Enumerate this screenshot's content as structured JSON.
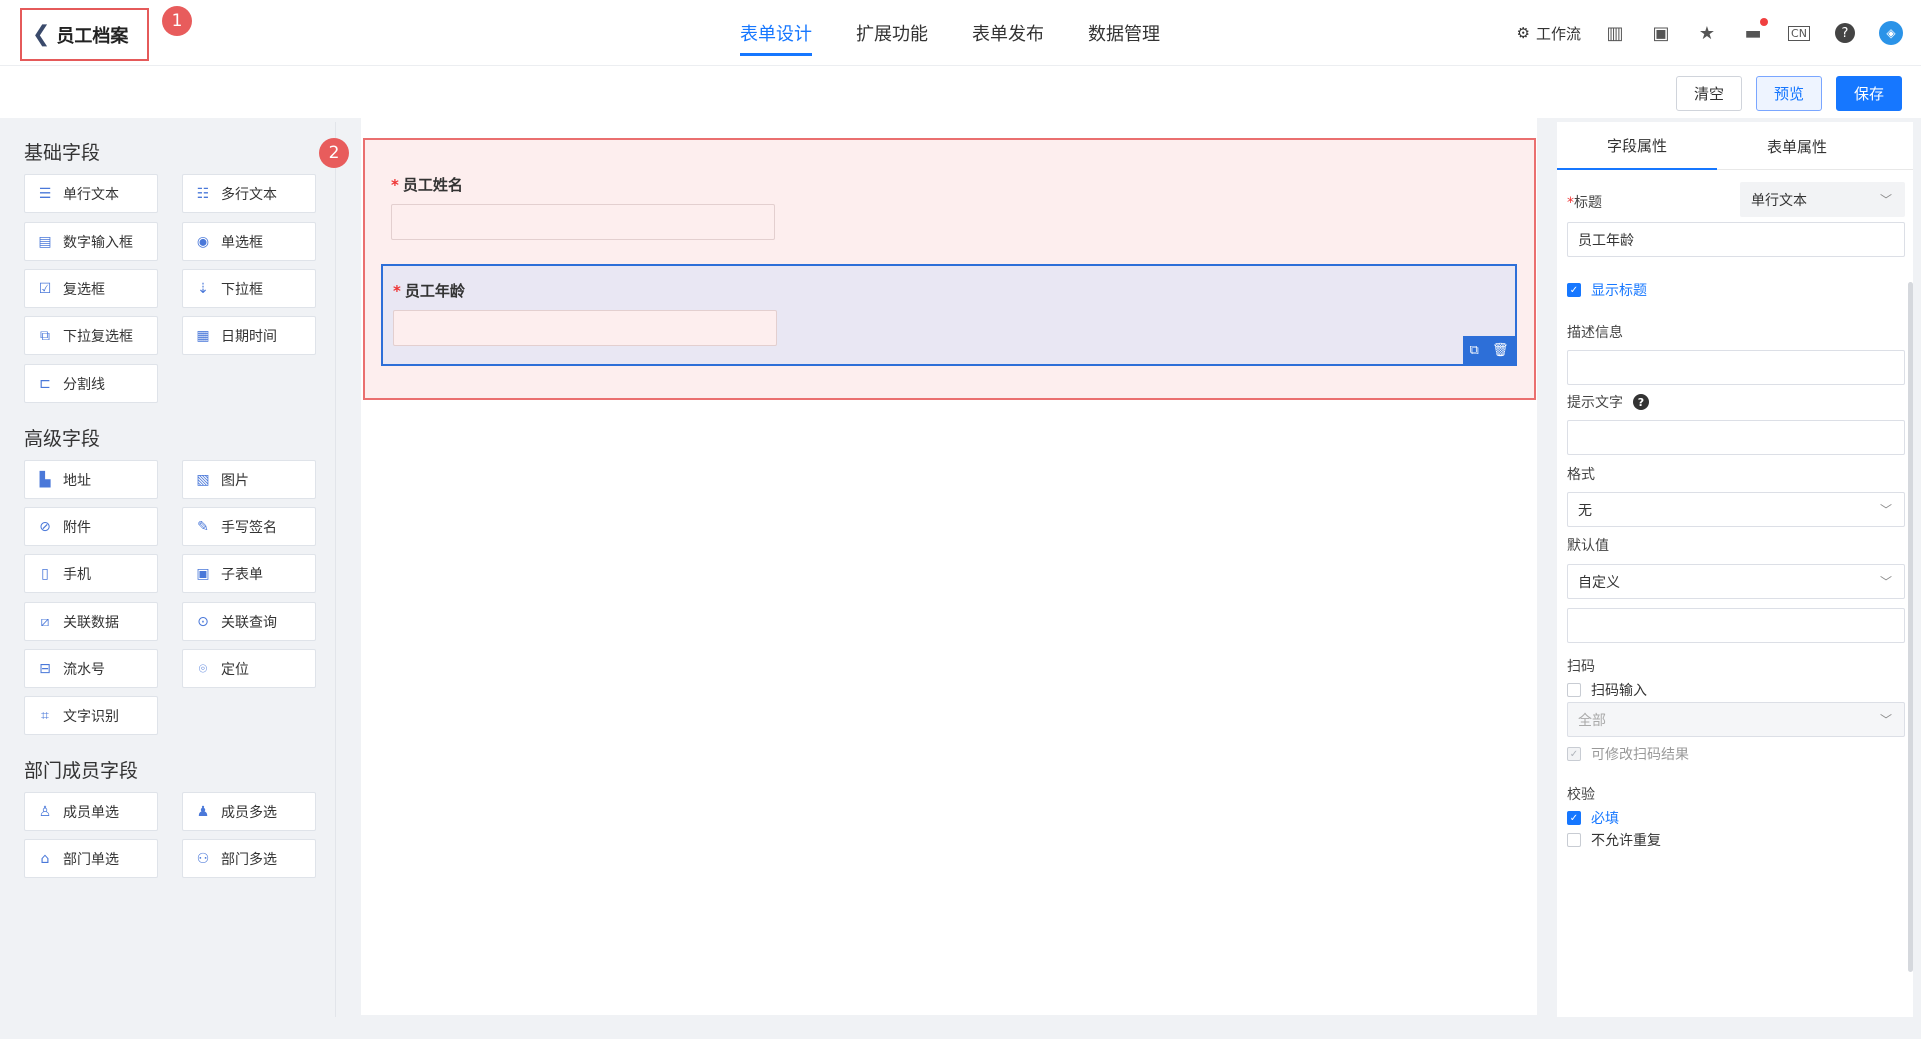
{
  "header": {
    "back_title": "员工档案",
    "badge_1": "1",
    "badge_2": "2",
    "tabs": [
      {
        "label": "表单设计"
      },
      {
        "label": "扩展功能"
      },
      {
        "label": "表单发布"
      },
      {
        "label": "数据管理"
      }
    ],
    "workflow_label": "工作流",
    "lang_label": "CN"
  },
  "actions": {
    "clear": "清空",
    "preview": "预览",
    "save": "保存"
  },
  "left": {
    "groups": [
      {
        "title": "基础字段"
      },
      {
        "title": "高级字段"
      },
      {
        "title": "部门成员字段"
      }
    ],
    "fields": [
      "单行文本",
      "多行文本",
      "数字输入框",
      "单选框",
      "复选框",
      "下拉框",
      "下拉复选框",
      "日期时间",
      "分割线",
      "地址",
      "图片",
      "附件",
      "手写签名",
      "手机",
      "子表单",
      "关联数据",
      "关联查询",
      "流水号",
      "定位",
      "文字识别",
      "成员单选",
      "成员多选",
      "部门单选",
      "部门多选"
    ]
  },
  "form": {
    "items": [
      {
        "label": "员工姓名",
        "required": "*"
      },
      {
        "label": "员工年龄",
        "required": "*"
      }
    ]
  },
  "right": {
    "tabs": [
      "字段属性",
      "表单属性"
    ],
    "title_label": "标题",
    "title_required": "*",
    "field_type": "单行文本",
    "title_value": "员工年龄",
    "show_title": "显示标题",
    "desc_label": "描述信息",
    "hint_label": "提示文字",
    "format_label": "格式",
    "format_value": "无",
    "default_label": "默认值",
    "default_value": "自定义",
    "scan_label": "扫码",
    "scan_input": "扫码输入",
    "scan_select": "全部",
    "scan_editable": "可修改扫码结果",
    "validate_label": "校验",
    "required_check": "必填",
    "no_dup_check": "不允许重复"
  }
}
